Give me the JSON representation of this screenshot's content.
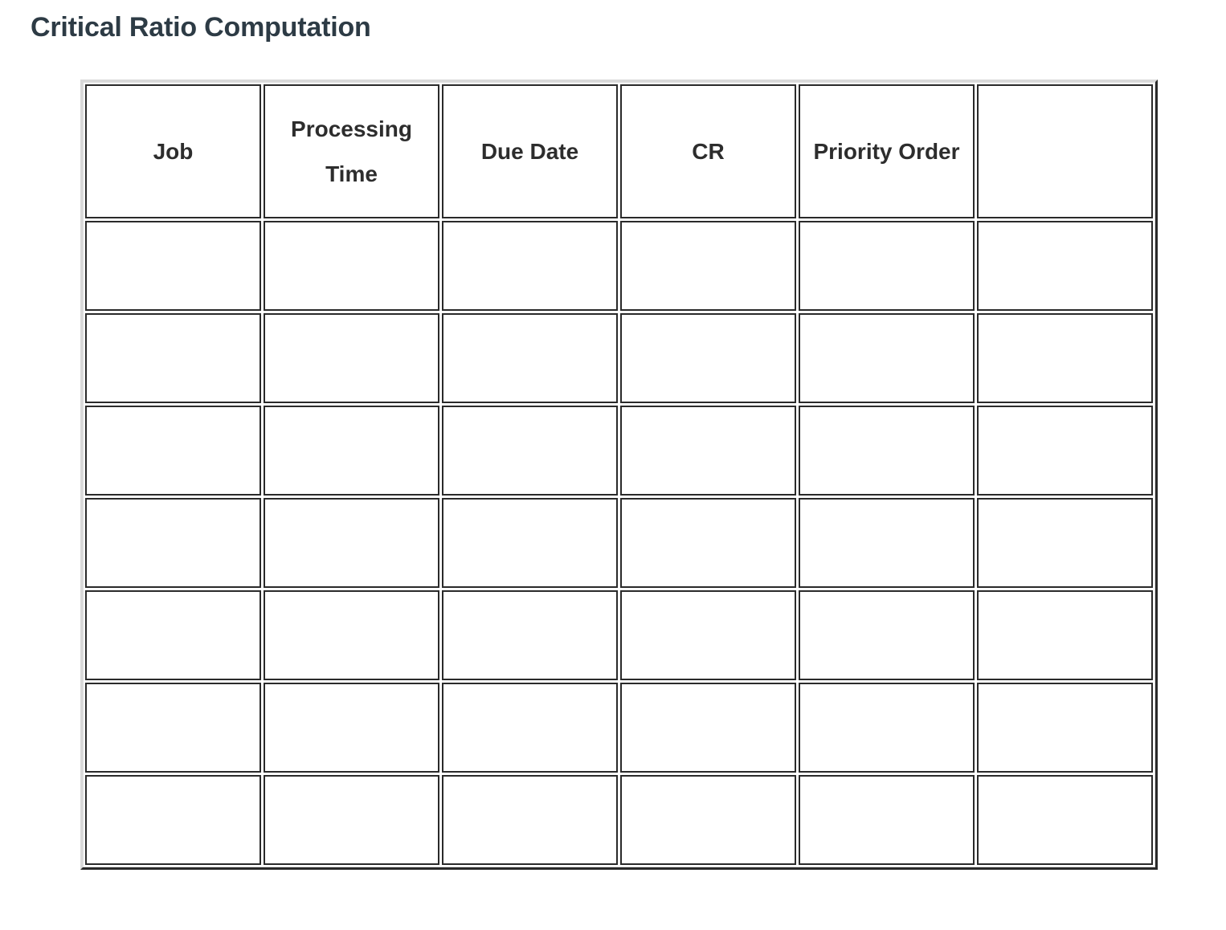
{
  "page": {
    "title": "Critical Ratio Computation",
    "background_color": "#ffffff",
    "text_color": "#2D3B45"
  },
  "colors": {
    "title": "#2D3B45",
    "cell_text": "#2d2d2d",
    "cell_border": "#2a2a2a",
    "grid_seam": "#dddddd",
    "cell_background": "#ffffff"
  },
  "table": {
    "name": "critical-ratio-computation-table",
    "column_count": 6,
    "header_row_count": 1,
    "body_row_count": 7,
    "headers": [
      "Job",
      "Processing Time",
      "Due Date",
      "CR",
      "Priority Order",
      ""
    ],
    "rows": [
      {
        "cells": [
          "",
          "",
          "",
          "",
          "",
          ""
        ]
      },
      {
        "cells": [
          "",
          "",
          "",
          "",
          "",
          ""
        ]
      },
      {
        "cells": [
          "",
          "",
          "",
          "",
          "",
          ""
        ]
      },
      {
        "cells": [
          "",
          "",
          "",
          "",
          "",
          ""
        ]
      },
      {
        "cells": [
          "",
          "",
          "",
          "",
          "",
          ""
        ]
      },
      {
        "cells": [
          "",
          "",
          "",
          "",
          "",
          ""
        ]
      },
      {
        "cells": [
          "",
          "",
          "",
          "",
          "",
          ""
        ]
      }
    ]
  }
}
